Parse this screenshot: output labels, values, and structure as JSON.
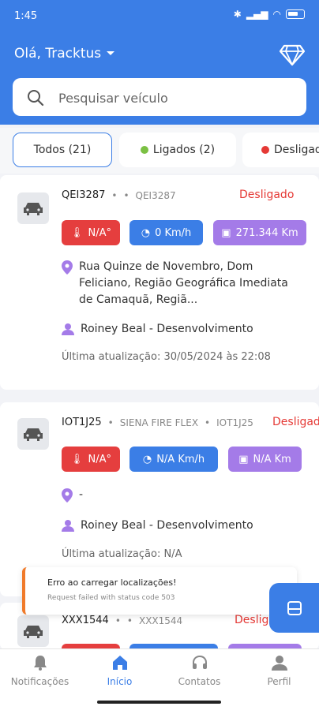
{
  "status_bar": {
    "time": "1:45",
    "battery_icon": "battery-icon"
  },
  "header": {
    "greeting": "Olá, Tracktus",
    "premium_icon": "diamond-icon"
  },
  "search": {
    "placeholder": "Pesquisar veículo",
    "icon": "search-icon"
  },
  "filters": [
    {
      "label": "Todos (21)",
      "active": true
    },
    {
      "label": "Ligados (2)",
      "dot_color": "#7bc043"
    },
    {
      "label": "Desligados",
      "dot_color": "#e53935"
    }
  ],
  "vehicles": [
    {
      "plate": "QEI3287",
      "model": "",
      "plate2": "QEI3287",
      "status": "Desligado",
      "temperature": "N/A°",
      "speed": "0 Km/h",
      "odometer": "271.344 Km",
      "address": "Rua Quinze de Novembro, Dom Feliciano, Região Geográfica Imediata de Camaquã, Regiã...",
      "driver": "Roiney Beal - Desenvolvimento",
      "updated": "Última atualização: 30/05/2024 às 22:08"
    },
    {
      "plate": "IOT1J25",
      "model": "SIENA FIRE FLEX",
      "plate2": "IOT1J25",
      "status": "Desligado",
      "temperature": "N/A°",
      "speed": "N/A Km/h",
      "odometer": "N/A Km",
      "address": "-",
      "driver": "Roiney Beal - Desenvolvimento",
      "updated": "Última atualização: N/A"
    },
    {
      "plate": "XXX1544",
      "plate2": "XXX1544",
      "status": "Desligado"
    }
  ],
  "toast": {
    "title": "Erro ao carregar localizações!",
    "message": "Request failed with status code 503",
    "accent": "#f07a2a"
  },
  "bottom_nav": [
    {
      "label": "Notificações",
      "icon": "bell-icon"
    },
    {
      "label": "Início",
      "icon": "home-icon",
      "active": true
    },
    {
      "label": "Contatos",
      "icon": "headset-icon"
    },
    {
      "label": "Perfil",
      "icon": "person-icon"
    }
  ],
  "colors": {
    "primary": "#3b7ee6",
    "danger": "#e53935",
    "purple": "#a47be8"
  }
}
